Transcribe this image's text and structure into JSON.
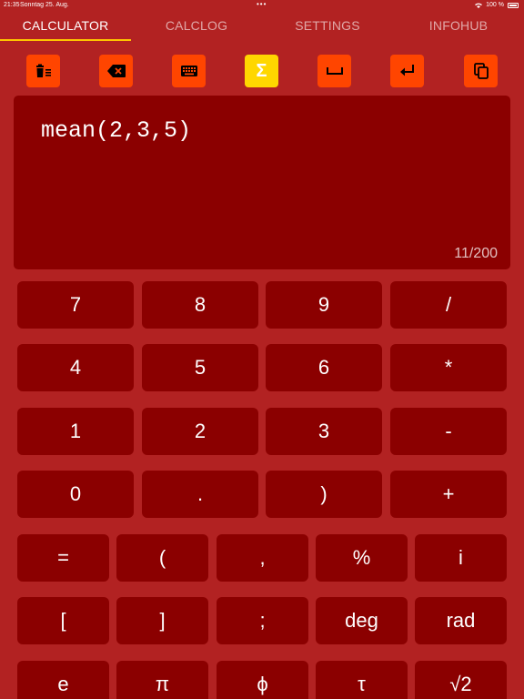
{
  "status": {
    "time": "21:35",
    "date": "Sonntag 25. Aug.",
    "battery": "100 %",
    "dots": "•••"
  },
  "tabs": [
    {
      "label": "CALCULATOR",
      "active": true
    },
    {
      "label": "CALCLOG",
      "active": false
    },
    {
      "label": "SETTINGS",
      "active": false
    },
    {
      "label": "INFOHUB",
      "active": false
    }
  ],
  "toolbar": [
    {
      "icon": "trash-list-icon",
      "highlighted": false
    },
    {
      "icon": "backspace-icon",
      "highlighted": false
    },
    {
      "icon": "keyboard-icon",
      "highlighted": false
    },
    {
      "icon": "sigma-icon",
      "label": "Σ",
      "highlighted": true
    },
    {
      "icon": "space-icon",
      "highlighted": false
    },
    {
      "icon": "return-icon",
      "highlighted": false
    },
    {
      "icon": "copy-icon",
      "highlighted": false
    }
  ],
  "display": {
    "expression": "mean(2,3,5)",
    "char_count": "11/200"
  },
  "keys": {
    "row1": [
      "7",
      "8",
      "9",
      "/"
    ],
    "row2": [
      "4",
      "5",
      "6",
      "*"
    ],
    "row3": [
      "1",
      "2",
      "3",
      "-"
    ],
    "row4": [
      "0",
      ".",
      ")",
      "+"
    ],
    "row5": [
      "=",
      "(",
      ",",
      "%",
      "i"
    ],
    "row6": [
      "[",
      "]",
      ";",
      "deg",
      "rad"
    ],
    "row7": [
      "e",
      "π",
      "ϕ",
      "τ",
      "√2"
    ]
  },
  "colors": {
    "background": "#b22222",
    "key": "#8b0000",
    "tool": "#ff4500",
    "tool_highlight": "#ffd700",
    "tab_indicator": "#ffc400"
  }
}
